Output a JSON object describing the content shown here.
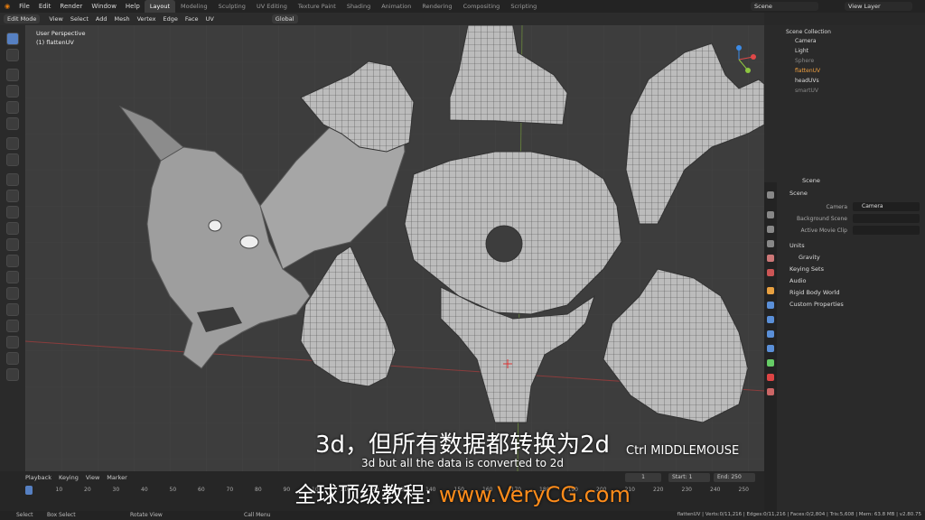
{
  "topbar": {
    "menus": [
      "File",
      "Edit",
      "Render",
      "Window",
      "Help"
    ],
    "tabs": [
      "Layout",
      "Modeling",
      "Sculpting",
      "UV Editing",
      "Texture Paint",
      "Shading",
      "Animation",
      "Rendering",
      "Compositing",
      "Scripting"
    ],
    "scene": "Scene",
    "view_layer": "View Layer"
  },
  "header": {
    "mode": "Edit Mode",
    "menus": [
      "View",
      "Select",
      "Add",
      "Mesh",
      "Vertex",
      "Edge",
      "Face",
      "UV"
    ],
    "orientation": "Global"
  },
  "viewport": {
    "view_name": "User Perspective",
    "object_name": "(1) flattenUV"
  },
  "outliner": {
    "collection": "Scene Collection",
    "items": [
      "Camera",
      "Light",
      "Sphere",
      "flattenUV",
      "headUVs",
      "smartUV"
    ]
  },
  "properties": {
    "header": "Scene",
    "section": "Scene",
    "camera_label": "Camera",
    "camera_value": "Camera",
    "bg_scene_label": "Background Scene",
    "movie_clip_label": "Active Movie Clip",
    "sections": [
      "Units",
      "Gravity",
      "Keying Sets",
      "Audio",
      "Rigid Body World",
      "Custom Properties"
    ]
  },
  "timeline": {
    "menus": [
      "Playback",
      "Keying",
      "View",
      "Marker"
    ],
    "current_frame": "1",
    "start_label": "Start:",
    "start": "1",
    "end_label": "End:",
    "end": "250",
    "ticks": [
      "1",
      "10",
      "20",
      "30",
      "40",
      "50",
      "60",
      "70",
      "80",
      "90",
      "100",
      "110",
      "120",
      "130",
      "140",
      "150",
      "160",
      "170",
      "180",
      "190",
      "200",
      "210",
      "220",
      "230",
      "240",
      "250"
    ]
  },
  "statusbar": {
    "select": "Select",
    "box_select": "Box Select",
    "rotate_view": "Rotate View",
    "call_menu": "Call Menu",
    "stats": "flattenUV | Verts:0/11,216 | Edges:0/11,216 | Faces:0/2,804 | Tris:5,608 | Mem: 63.8 MB | v2.80.75"
  },
  "overlay": {
    "subtitle_cn": "3d，但所有数据都转换为2d",
    "subtitle_en": "3d but all the data is converted to 2d",
    "key_hint": "Ctrl MIDDLEMOUSE",
    "watermark_cn": "全球顶级教程: ",
    "watermark_url": "www.VeryCG.com"
  },
  "colors": {
    "accent": "#5680c2",
    "active_tab": "#3d3d3d",
    "watermark_url": "#ff8c1a"
  }
}
